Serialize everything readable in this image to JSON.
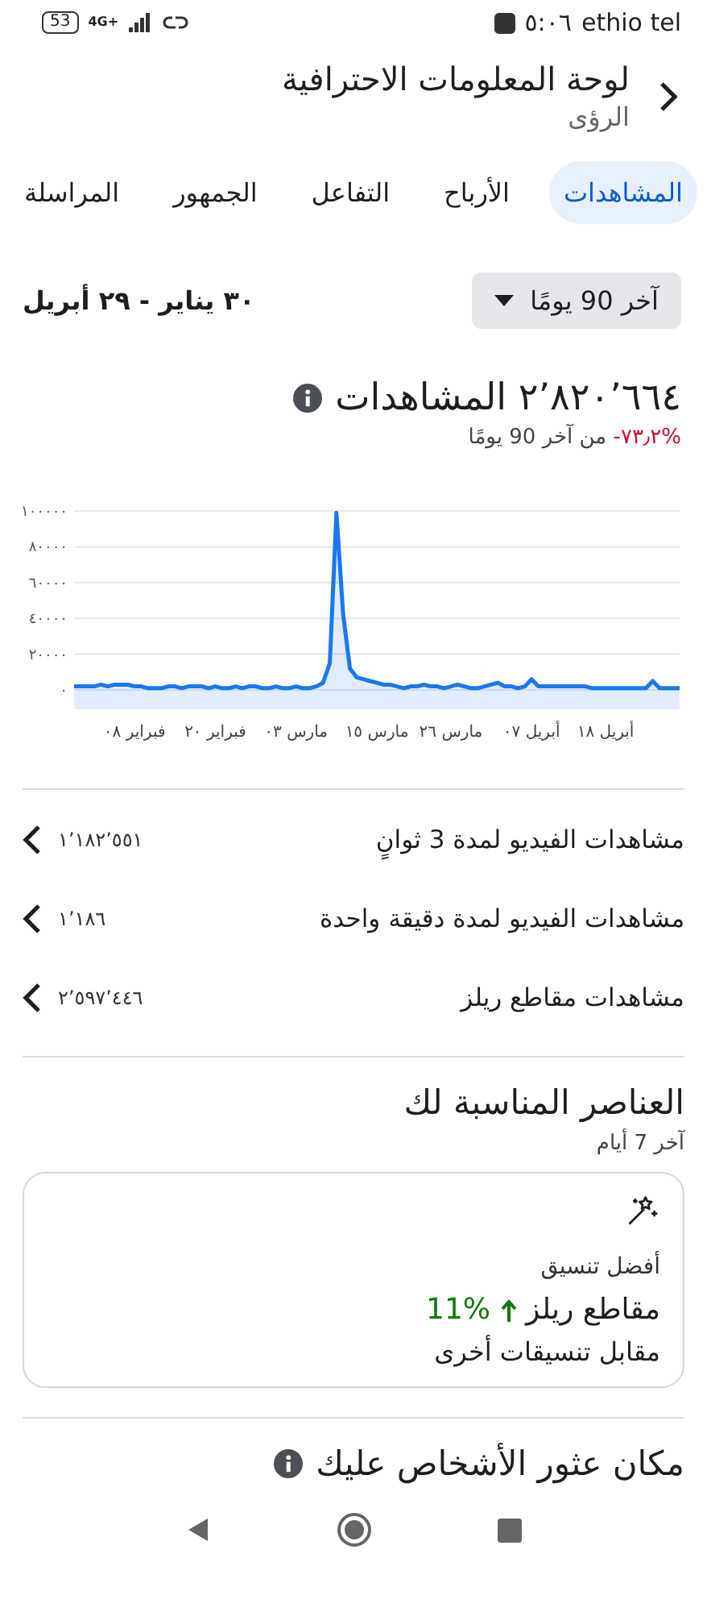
{
  "status_bar": {
    "carrier": "ethio tel",
    "time": "٥:٠٦",
    "network": "4G+",
    "battery": "53"
  },
  "header": {
    "title": "لوحة المعلومات الاحترافية",
    "subtitle": "الرؤى"
  },
  "tabs": [
    {
      "label": "المشاهدات",
      "selected": true
    },
    {
      "label": "الأرباح",
      "selected": false
    },
    {
      "label": "التفاعل",
      "selected": false
    },
    {
      "label": "الجمهور",
      "selected": false
    },
    {
      "label": "المراسلة",
      "selected": false
    }
  ],
  "range": {
    "dropdown": "آخر 90 يومًا",
    "dates": "٣٠ يناير - ٢٩ أبريل"
  },
  "views": {
    "total": "٢٬٨٢٠٬٦٦٤",
    "label": "المشاهدات",
    "change": "-٧٣٫٢%",
    "change_text": "من آخر 90 يومًا",
    "chart_data": {
      "type": "area",
      "categories": [
        null,
        null,
        null,
        null,
        null,
        null,
        null,
        null,
        null,
        "فبراير ٠٨",
        null,
        null,
        null,
        null,
        null,
        null,
        null,
        null,
        null,
        null,
        null,
        "فبراير ٢٠",
        null,
        null,
        null,
        null,
        null,
        null,
        null,
        null,
        null,
        null,
        null,
        "مارس ٠٣",
        null,
        null,
        null,
        null,
        null,
        null,
        null,
        null,
        null,
        null,
        null,
        "مارس ١٥",
        null,
        null,
        null,
        null,
        null,
        null,
        null,
        null,
        null,
        null,
        "مارس ٢٦",
        null,
        null,
        null,
        null,
        null,
        null,
        null,
        null,
        null,
        null,
        null,
        "أبريل ٠٧",
        null,
        null,
        null,
        null,
        null,
        null,
        null,
        null,
        null,
        null,
        "أبريل ١٨",
        null,
        null,
        null,
        null,
        null,
        null,
        null,
        null,
        null,
        null,
        null
      ],
      "series": [
        {
          "color": "#1877f2",
          "values": [
            2000,
            2000,
            2000,
            2000,
            3000,
            2000,
            3000,
            3000,
            3000,
            2000,
            2000,
            1000,
            1000,
            1000,
            2000,
            2000,
            1000,
            2000,
            2000,
            2000,
            1000,
            2000,
            1000,
            1000,
            2000,
            1000,
            2000,
            2000,
            1000,
            1000,
            2000,
            1000,
            1000,
            2000,
            1000,
            1000,
            2000,
            4000,
            15000,
            99000,
            42000,
            12000,
            7000,
            6000,
            5000,
            4000,
            3000,
            3000,
            2000,
            1000,
            2000,
            2000,
            3000,
            2000,
            2000,
            1000,
            2000,
            3000,
            2000,
            1000,
            1000,
            2000,
            3000,
            4000,
            2000,
            2000,
            1000,
            2000,
            6000,
            2000,
            2000,
            2000,
            2000,
            2000,
            2000,
            2000,
            2000,
            1000,
            1000,
            1000,
            1000,
            1000,
            1000,
            1000,
            1000,
            1000,
            5000,
            1000,
            1000,
            1000,
            1000
          ]
        }
      ],
      "ylim": [
        0,
        100000
      ],
      "grid": true,
      "yticks": [
        {
          "value": 0,
          "label": "٠"
        },
        {
          "value": 20000,
          "label": "٢٠٠٠٠"
        },
        {
          "value": 40000,
          "label": "٤٠٠٠٠"
        },
        {
          "value": 60000,
          "label": "٦٠٠٠٠"
        },
        {
          "value": 80000,
          "label": "٨٠٠٠٠"
        },
        {
          "value": 100000,
          "label": "١٠٠٠٠٠"
        }
      ]
    }
  },
  "metrics": [
    {
      "label": "مشاهدات الفيديو لمدة 3 ثوانٍ",
      "value": "١٬١٨٢٬٥٥١"
    },
    {
      "label": "مشاهدات الفيديو لمدة دقيقة واحدة",
      "value": "١٬١٨٦"
    },
    {
      "label": "مشاهدات مقاطع ريلز",
      "value": "٢٬٥٩٧٬٤٤٦"
    }
  ],
  "recommended": {
    "title": "العناصر المناسبة لك",
    "subtitle": "آخر 7 أيام",
    "card": {
      "eyebrow": "أفضل تنسيق",
      "format": "مقاطع ريلز",
      "change": "11%",
      "comparison": "مقابل تنسيقات أخرى"
    }
  },
  "discovery": {
    "title": "مكان عثور الأشخاص عليك"
  }
}
